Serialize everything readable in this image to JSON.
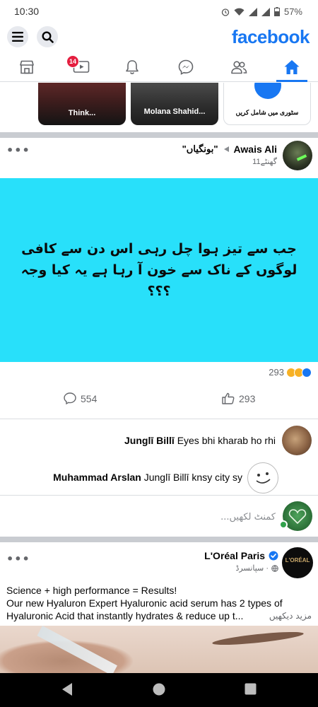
{
  "status_bar": {
    "time": "10:30",
    "battery": "57%"
  },
  "header": {
    "logo": "facebook"
  },
  "nav": {
    "watch_badge": "14"
  },
  "stories": [
    {
      "caption": "Think..."
    },
    {
      "caption": "Molana Shahid..."
    },
    {
      "caption": "سٹوری میں شامل کریں"
    }
  ],
  "post1": {
    "author": "Awais Ali",
    "group": "\"بونگیاں\"",
    "time": "11گھنٹے",
    "text": "جب سے تیز ہوا چل رہی اس دن سے کافی لوگوں کے ناک سے خون آ رہا ہے یہ کیا وجہ ؟؟؟",
    "reactions_count": "293",
    "comments_count": "554",
    "likes_count": "293",
    "comments": [
      {
        "author": "Junglī Billī",
        "text": "Eyes bhi kharab ho rhi"
      },
      {
        "author": "Muhammad Arslan",
        "text": "Junglī Billī knsy city sy"
      }
    ],
    "comment_placeholder": "کمنٹ لکھیں..."
  },
  "post2": {
    "author": "L'Oréal Paris",
    "time": "سپانسرڈ ·",
    "text_line1": "Science + high performance = Results!",
    "text_line2": "Our new Hyaluron Expert Hyaluronic acid serum has 2 types of",
    "text_line3": "Hyaluronic Acid that instantly hydrates & reduce up t...",
    "see_more": "مزید دیکھیں",
    "logo_text": "L'ORÉAL"
  },
  "colors": {
    "brand": "#1877f2",
    "banner": "#28e0fa",
    "separator": "#c9ccd1"
  }
}
